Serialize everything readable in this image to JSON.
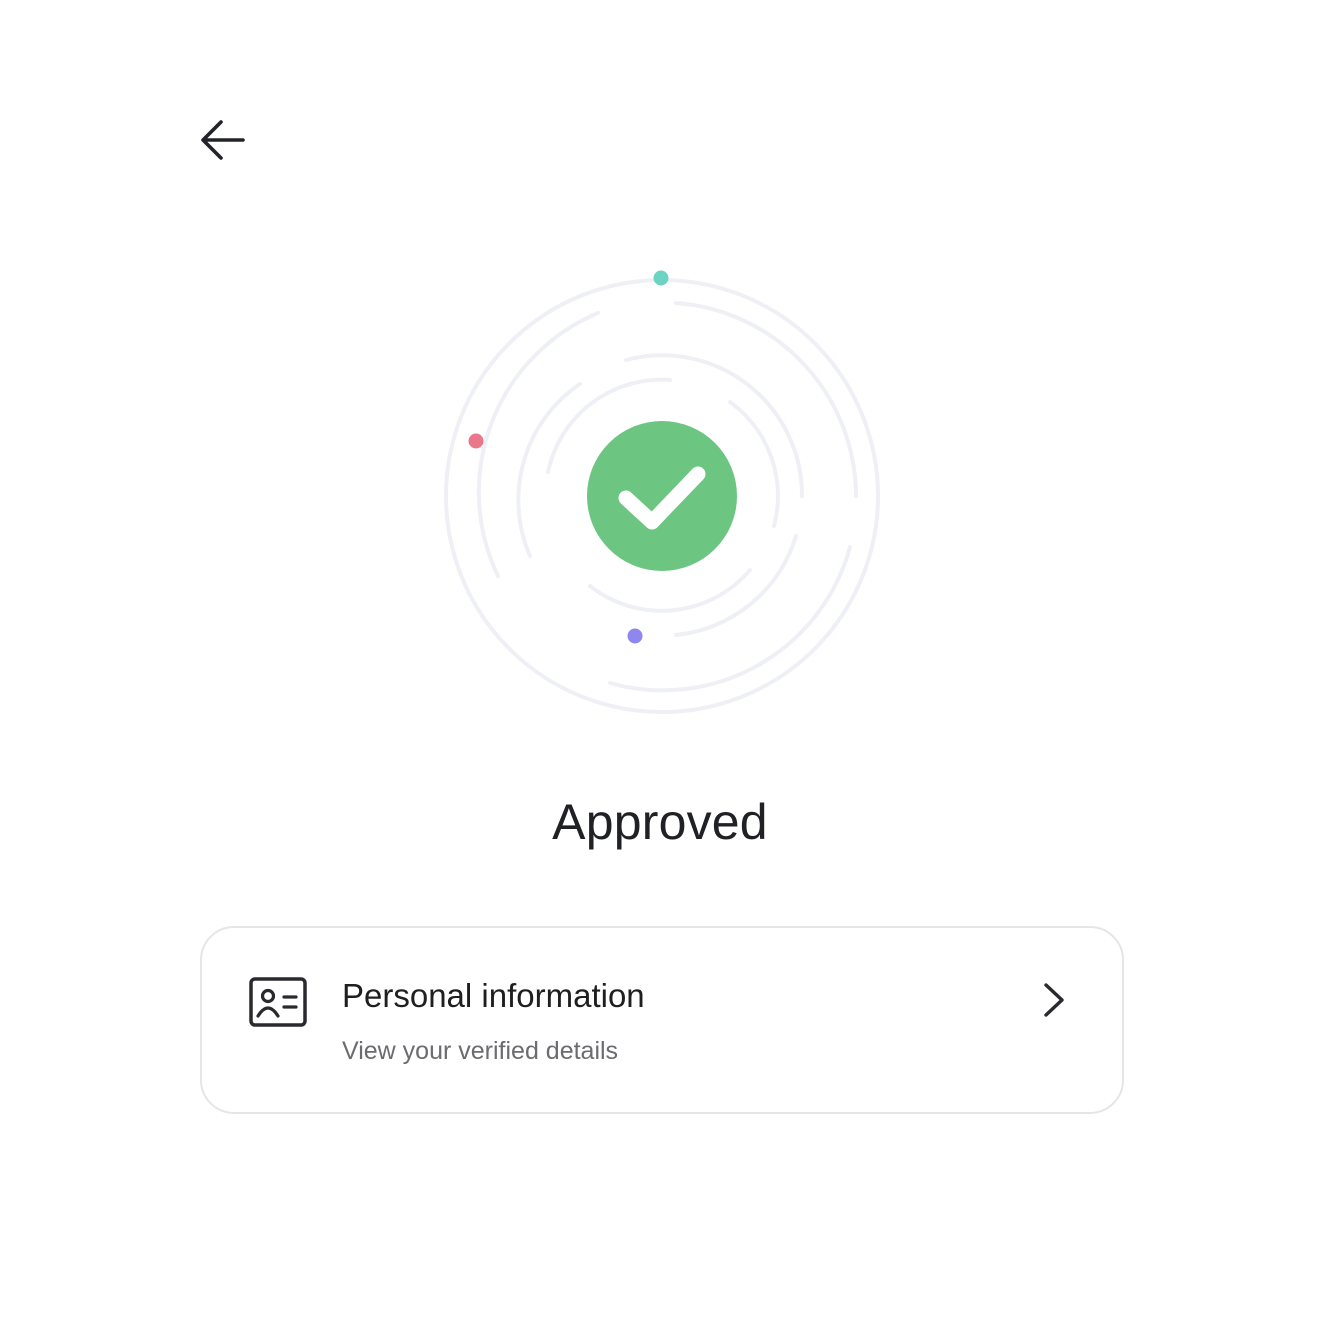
{
  "header": {
    "back_icon": "arrow-left-icon"
  },
  "status": {
    "icon": "check-circle-icon",
    "title": "Approved",
    "colors": {
      "success": "#6cc581",
      "dot_teal": "#6dd3c2",
      "dot_red": "#e9798a",
      "dot_purple": "#8f86ee",
      "ring": "#eef0f6"
    }
  },
  "card": {
    "icon": "id-card-icon",
    "title": "Personal information",
    "subtitle": "View your verified details",
    "chevron_icon": "chevron-right-icon"
  }
}
